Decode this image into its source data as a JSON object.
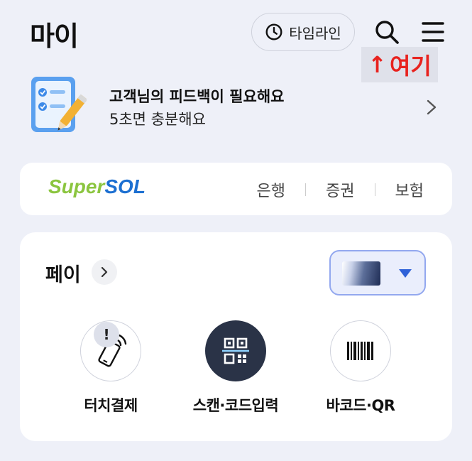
{
  "header": {
    "title": "마이",
    "timeline_label": "타임라인",
    "icons": {
      "timeline": "clock-icon",
      "search": "search-icon",
      "menu": "hamburger-menu-icon"
    }
  },
  "annotation": {
    "arrow": "↑",
    "text": "여기",
    "color": "#e8231f"
  },
  "feedback": {
    "title": "고객님의 피드백이 필요해요",
    "subtitle": "5초면 충분해요",
    "icon": "checklist-pencil-icon"
  },
  "supersol": {
    "logo_super": "Super",
    "logo_sol": "SOL",
    "links": [
      "은행",
      "증권",
      "보험"
    ],
    "brand_colors": {
      "super": "#8bc53f",
      "sol": "#1c6fd1"
    }
  },
  "pay": {
    "title": "페이",
    "selected_card": "card-thumbnail",
    "items": [
      {
        "label": "터치결제",
        "icon": "phone-tap-icon",
        "badge": "!"
      },
      {
        "label": "스캔·코드입력",
        "icon": "qr-scan-icon"
      },
      {
        "label": "바코드·QR",
        "icon": "barcode-icon"
      }
    ]
  }
}
